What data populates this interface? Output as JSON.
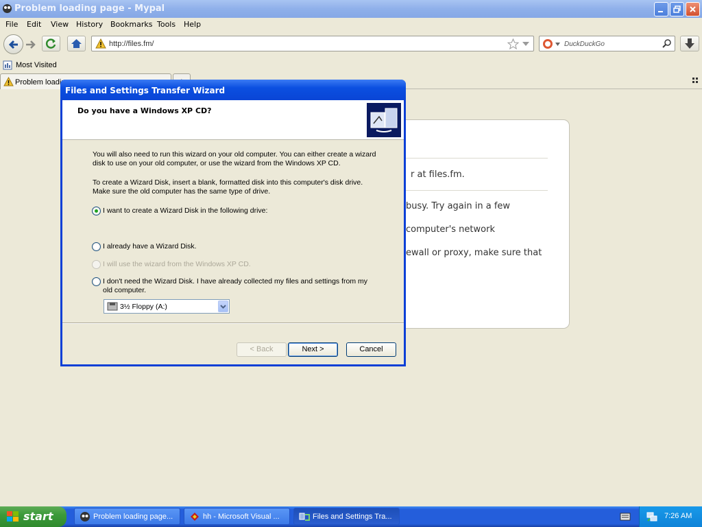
{
  "window": {
    "title": "Problem loading page - Mypal"
  },
  "menu": [
    "File",
    "Edit",
    "View",
    "History",
    "Bookmarks",
    "Tools",
    "Help"
  ],
  "address": {
    "url": "http://files.fm/",
    "search_placeholder": "DuckDuckGo"
  },
  "bookmarks": {
    "most_visited": "Most Visited"
  },
  "tab": {
    "label": "Problem loading page",
    "new_tab": "+"
  },
  "error_page": {
    "line1": "r at files.fm.",
    "line2": "busy. Try again in a few",
    "line3": "computer's network",
    "line4": "ewall or proxy, make sure that"
  },
  "wizard": {
    "title": "Files and Settings Transfer Wizard",
    "heading": "Do you have a Windows XP CD?",
    "para1": "You will also need to run this wizard on your old computer. You can either create a wizard disk to use on your old computer, or use the wizard from the Windows XP CD.",
    "para2": "To create a Wizard Disk, insert a blank, formatted disk into this computer's disk drive. Make sure the old computer has the same type of drive.",
    "options": [
      {
        "label": "I want to create a Wizard Disk in the following drive:",
        "checked": true,
        "enabled": true
      },
      {
        "label": "I already have a Wizard Disk.",
        "checked": false,
        "enabled": true
      },
      {
        "label": "I will use the wizard from the Windows XP CD.",
        "checked": false,
        "enabled": false
      },
      {
        "label": "I don't need the Wizard Disk. I have already collected my files and settings from my old computer.",
        "checked": false,
        "enabled": true
      }
    ],
    "drive": "3½ Floppy (A:)",
    "back": "< Back",
    "next": "Next >",
    "cancel": "Cancel"
  },
  "taskbar": {
    "start": "start",
    "tasks": [
      {
        "label": "Problem loading page...",
        "active": false
      },
      {
        "label": "hh - Microsoft Visual ...",
        "active": false
      },
      {
        "label": "Files and Settings Tra...",
        "active": true
      }
    ],
    "clock": "7:26 AM"
  }
}
